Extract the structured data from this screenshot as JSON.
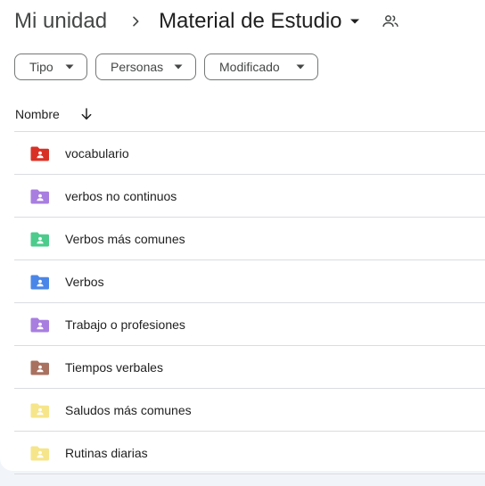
{
  "breadcrumb": {
    "root": "Mi unidad",
    "current": "Material de Estudio",
    "separator_icon": "chevron-right-icon",
    "caret_icon": "caret-down-icon",
    "shared_icon": "shared-people-icon"
  },
  "filters": [
    {
      "label": "Tipo",
      "icon": "caret-down-icon"
    },
    {
      "label": "Personas",
      "icon": "caret-down-icon"
    },
    {
      "label": "Modificado",
      "icon": "caret-down-icon"
    }
  ],
  "list_header": {
    "name_label": "Nombre",
    "sort_icon": "arrow-down-icon"
  },
  "folders": [
    {
      "name": "vocabulario",
      "color": "#d93025"
    },
    {
      "name": "verbos no continuos",
      "color": "#a87ee0"
    },
    {
      "name": "Verbos más comunes",
      "color": "#4ccb8c"
    },
    {
      "name": "Verbos",
      "color": "#4a86e8"
    },
    {
      "name": "Trabajo o profesiones",
      "color": "#a87ee0"
    },
    {
      "name": "Tiempos verbales",
      "color": "#a87160"
    },
    {
      "name": "Saludos más comunes",
      "color": "#f6e58a"
    },
    {
      "name": "Rutinas diarias",
      "color": "#f6e58a"
    }
  ]
}
